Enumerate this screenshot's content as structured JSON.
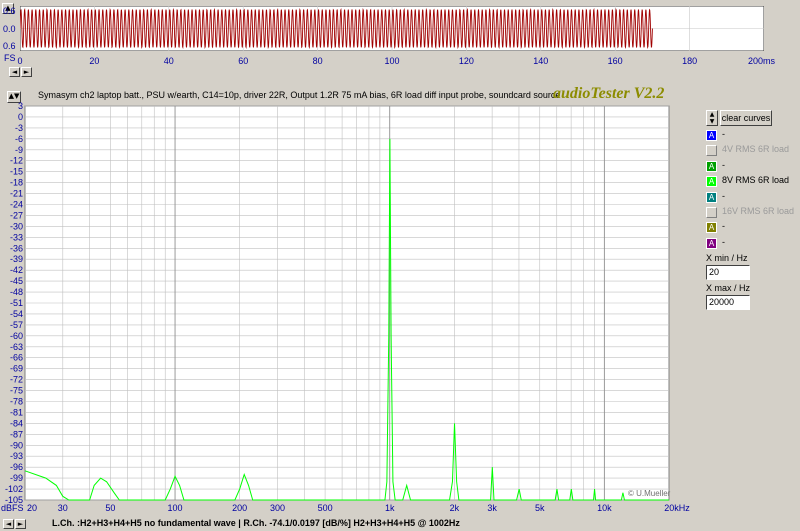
{
  "scope": {
    "y_labels": [
      "0.6",
      "0.0",
      "0.6"
    ],
    "x_ticks": [
      0,
      20,
      40,
      60,
      80,
      100,
      120,
      140,
      160,
      180
    ],
    "x_unit_label": "200ms",
    "range_label": "FS",
    "wave_color": "#a00000"
  },
  "header": {
    "description": "Symasym ch2 laptop batt., PSU w/earth, C14=10p, driver 22R, Output 1.2R 75 mA bias, 6R load diff input probe, soundcard source",
    "brand": "audioTester V2.2"
  },
  "controls": {
    "clear_label": "clear curves",
    "xmin_label": "X min / Hz",
    "xmin_value": "20",
    "xmax_label": "X max / Hz",
    "xmax_value": "20000"
  },
  "legend": [
    {
      "text": "-",
      "color": "#0000ff",
      "checked": true,
      "dim": false
    },
    {
      "text": "4V RMS 6R load",
      "color": "#d4d0c8",
      "checked": false,
      "dim": true
    },
    {
      "text": "-",
      "color": "#00a000",
      "checked": true,
      "dim": false
    },
    {
      "text": "8V RMS 6R load",
      "color": "#00ff00",
      "checked": true,
      "dim": false
    },
    {
      "text": "-",
      "color": "#008080",
      "checked": true,
      "dim": false
    },
    {
      "text": "16V RMS 6R load",
      "color": "#d4d0c8",
      "checked": false,
      "dim": true
    },
    {
      "text": "-",
      "color": "#808000",
      "checked": true,
      "dim": false
    },
    {
      "text": "-",
      "color": "#800080",
      "checked": true,
      "dim": false
    }
  ],
  "legend_box_letter": "A",
  "status": "L.Ch. :H2+H3+H4+H5 no fundamental wave | R.Ch. -74.1/0.0197 [dB/%] H2+H3+H4+H5 @ 1002Hz",
  "watermark": "© U.Mueller",
  "chart_data": {
    "type": "line",
    "title": "",
    "xlabel": "",
    "ylabel": "",
    "x_scale": "log",
    "xlim": [
      20,
      20000
    ],
    "ylim": [
      -105,
      3
    ],
    "y_ticks": [
      3,
      0,
      -3,
      -6,
      -9,
      -12,
      -15,
      -18,
      -21,
      -24,
      -27,
      -30,
      -33,
      -36,
      -39,
      -42,
      -45,
      -48,
      -51,
      -54,
      -57,
      -60,
      -63,
      -66,
      -69,
      -72,
      -75,
      -78,
      -81,
      -84,
      -87,
      -90,
      -93,
      -96,
      -99,
      -102,
      -105
    ],
    "y_unit_label": "dBFS",
    "x_tick_labels": [
      {
        "v": 20,
        "t": "20"
      },
      {
        "v": 30,
        "t": "30"
      },
      {
        "v": 50,
        "t": "50"
      },
      {
        "v": 100,
        "t": "100"
      },
      {
        "v": 200,
        "t": "200"
      },
      {
        "v": 300,
        "t": "300"
      },
      {
        "v": 500,
        "t": "500"
      },
      {
        "v": 1000,
        "t": "1k"
      },
      {
        "v": 2000,
        "t": "2k"
      },
      {
        "v": 3000,
        "t": "3k"
      },
      {
        "v": 5000,
        "t": "5k"
      },
      {
        "v": 10000,
        "t": "10k"
      },
      {
        "v": 20000,
        "t": "20kHz"
      }
    ],
    "grid": true,
    "series": [
      {
        "color": "#00ff00",
        "points": [
          [
            20,
            -97
          ],
          [
            25,
            -99
          ],
          [
            28,
            -101
          ],
          [
            30,
            -104
          ],
          [
            32,
            -105
          ],
          [
            40,
            -105
          ],
          [
            42,
            -101
          ],
          [
            45,
            -99
          ],
          [
            48,
            -100
          ],
          [
            52,
            -103
          ],
          [
            55,
            -105
          ],
          [
            90,
            -105
          ],
          [
            95,
            -102
          ],
          [
            100,
            -98.5
          ],
          [
            105,
            -101
          ],
          [
            110,
            -105
          ],
          [
            190,
            -105
          ],
          [
            200,
            -102
          ],
          [
            210,
            -98
          ],
          [
            220,
            -101
          ],
          [
            230,
            -105
          ],
          [
            950,
            -105
          ],
          [
            970,
            -100
          ],
          [
            990,
            -60
          ],
          [
            1002,
            -6
          ],
          [
            1015,
            -60
          ],
          [
            1035,
            -100
          ],
          [
            1060,
            -105
          ],
          [
            1150,
            -105
          ],
          [
            1200,
            -101
          ],
          [
            1250,
            -105
          ],
          [
            1900,
            -105
          ],
          [
            1960,
            -100
          ],
          [
            2004,
            -84
          ],
          [
            2050,
            -100
          ],
          [
            2100,
            -105
          ],
          [
            2950,
            -105
          ],
          [
            3006,
            -96
          ],
          [
            3060,
            -105
          ],
          [
            3900,
            -105
          ],
          [
            4008,
            -102
          ],
          [
            4100,
            -105
          ],
          [
            5900,
            -105
          ],
          [
            6012,
            -102
          ],
          [
            6120,
            -105
          ],
          [
            6900,
            -105
          ],
          [
            7014,
            -102
          ],
          [
            7130,
            -105
          ],
          [
            8900,
            -105
          ],
          [
            9000,
            -102
          ],
          [
            9100,
            -105
          ],
          [
            12000,
            -105
          ],
          [
            12200,
            -103
          ],
          [
            12400,
            -105
          ],
          [
            20000,
            -105
          ]
        ]
      }
    ]
  }
}
